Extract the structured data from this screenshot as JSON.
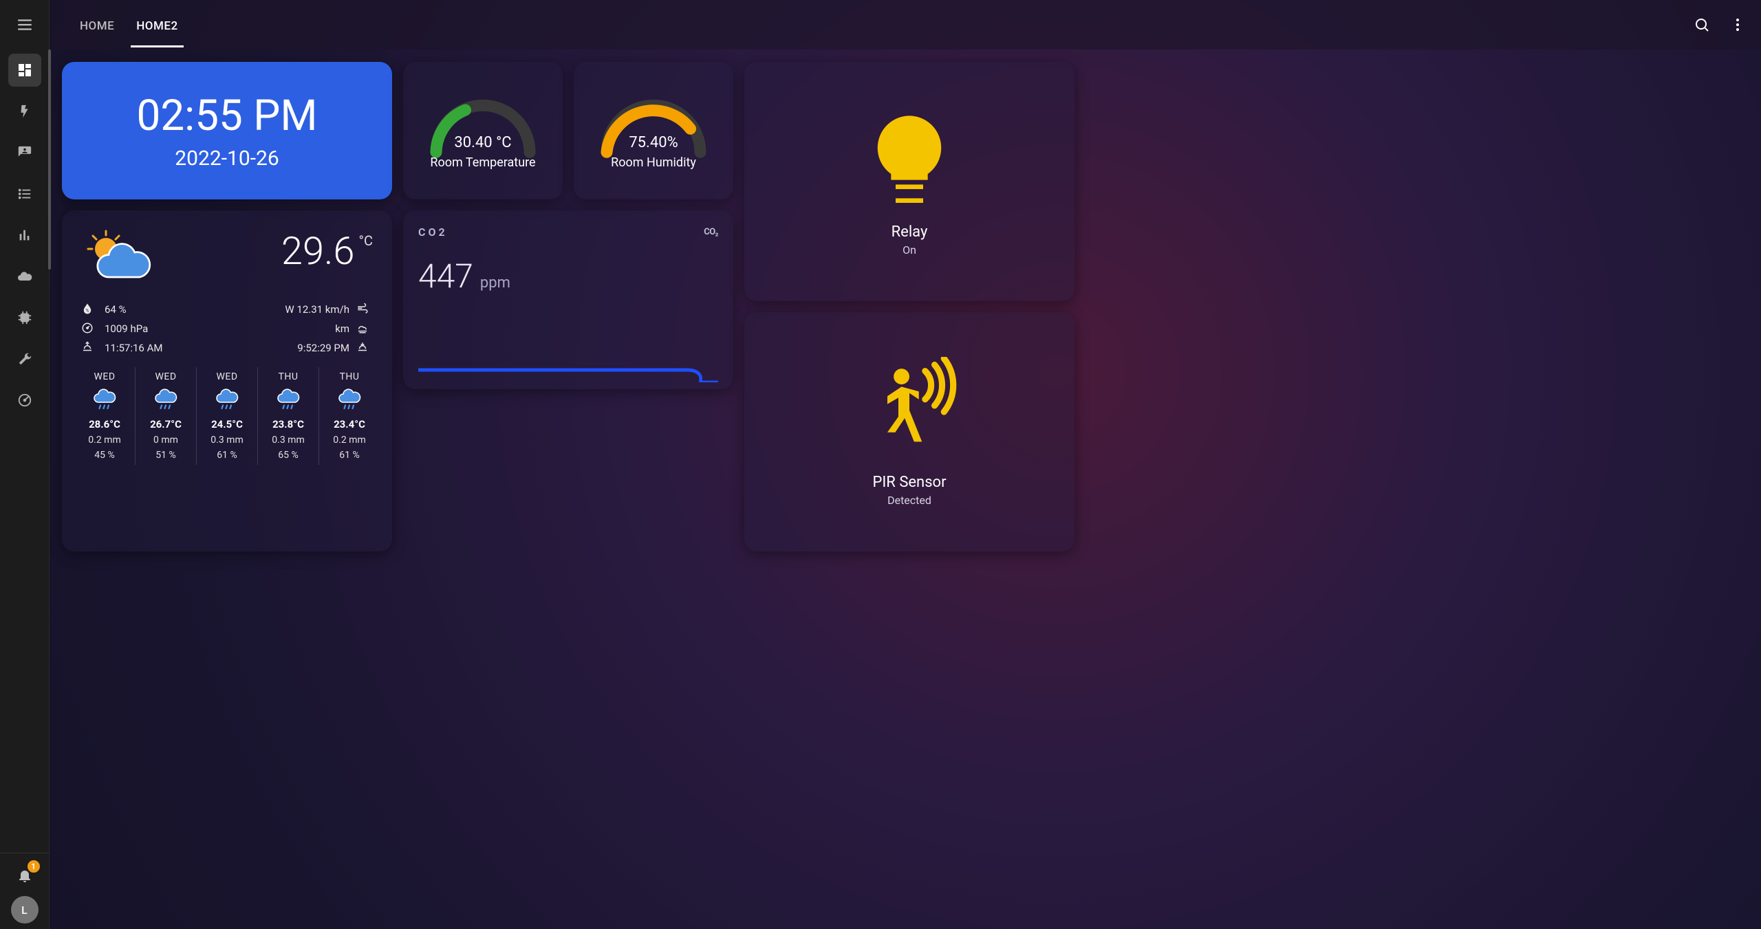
{
  "sidebar": {
    "notification_count": "1",
    "avatar_initial": "L"
  },
  "tabs": [
    "HOME",
    "HOME2"
  ],
  "active_tab": 1,
  "clock": {
    "time": "02:55 PM",
    "date": "2022-10-26"
  },
  "weather": {
    "temp": "29.6",
    "temp_unit": "°C",
    "humidity": "64 %",
    "pressure": "1009 hPa",
    "sunrise": "11:57:16 AM",
    "wind": "W 12.31 km/h",
    "visibility": "km",
    "sunset": "9:52:29 PM",
    "forecast": [
      {
        "day": "WED",
        "temp": "28.6°C",
        "precip": "0.2 mm",
        "humidity": "45 %"
      },
      {
        "day": "WED",
        "temp": "26.7°C",
        "precip": "0 mm",
        "humidity": "51 %"
      },
      {
        "day": "WED",
        "temp": "24.5°C",
        "precip": "0.3 mm",
        "humidity": "61 %"
      },
      {
        "day": "THU",
        "temp": "23.8°C",
        "precip": "0.3 mm",
        "humidity": "65 %"
      },
      {
        "day": "THU",
        "temp": "23.4°C",
        "precip": "0.2 mm",
        "humidity": "61 %"
      }
    ]
  },
  "gauges": {
    "temp": {
      "label": "Room Temperature",
      "value": "30.40 °C"
    },
    "hum": {
      "label": "Room Humidity",
      "value": "75.40%"
    }
  },
  "co2": {
    "title": "CO2",
    "value": "447",
    "unit": "ppm"
  },
  "relay": {
    "title": "Relay",
    "state": "On"
  },
  "pir": {
    "title": "PIR Sensor",
    "state": "Detected"
  },
  "chart_data": [
    {
      "type": "line",
      "title": "CO2",
      "ylabel": "ppm",
      "series": [
        {
          "name": "CO2",
          "values": [
            447,
            447,
            447,
            447,
            447,
            447,
            447,
            447,
            447,
            447
          ]
        }
      ],
      "ylim": [
        0,
        2000
      ]
    }
  ]
}
